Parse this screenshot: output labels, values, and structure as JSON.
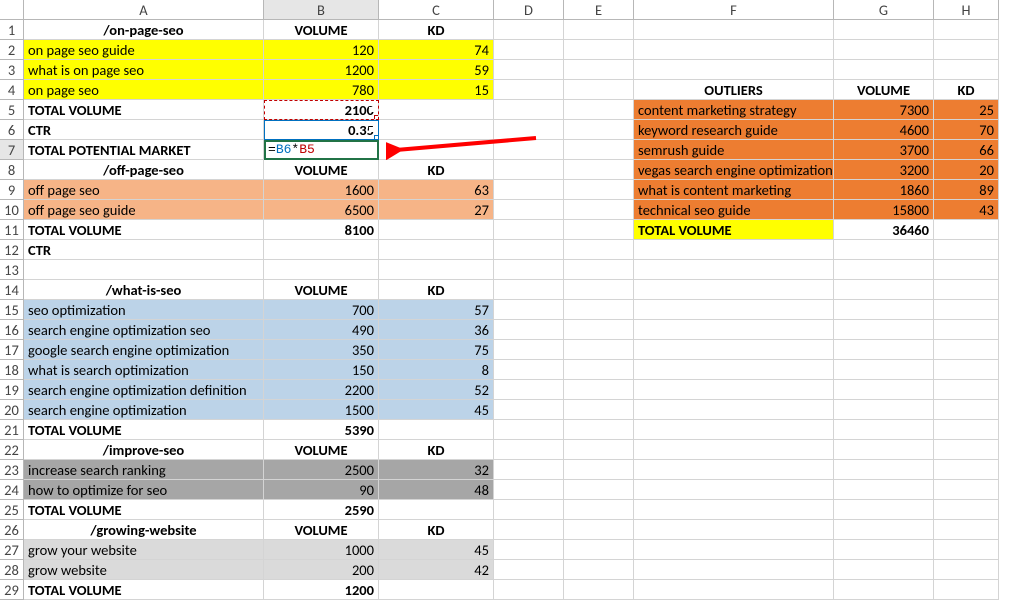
{
  "columns": [
    "A",
    "B",
    "C",
    "D",
    "E",
    "F",
    "G",
    "H"
  ],
  "chart_data": null,
  "header1": {
    "A": "/on-page-seo",
    "B": "VOLUME",
    "C": "KD"
  },
  "onpage": [
    {
      "A": "on page seo guide",
      "B": "120",
      "C": "74"
    },
    {
      "A": "what is on page seo",
      "B": "1200",
      "C": "59"
    },
    {
      "A": "on page seo",
      "B": "780",
      "C": "15"
    }
  ],
  "totalvol1": {
    "A": "TOTAL VOLUME",
    "B": "2100"
  },
  "ctr1": {
    "A": "CTR",
    "B": "0.35"
  },
  "tpm": {
    "A": "TOTAL POTENTIAL MARKET",
    "formula_prefix": "=",
    "ref1": "B6",
    "op": "*",
    "ref2": "B5"
  },
  "header2": {
    "A": "/off-page-seo",
    "B": "VOLUME",
    "C": "KD"
  },
  "offpage": [
    {
      "A": "off page seo",
      "B": "1600",
      "C": "63"
    },
    {
      "A": "off page seo guide",
      "B": "6500",
      "C": "27"
    }
  ],
  "totalvol2": {
    "A": "TOTAL VOLUME",
    "B": "8100"
  },
  "ctr2": {
    "A": "CTR"
  },
  "header3": {
    "A": "/what-is-seo",
    "B": "VOLUME",
    "C": "KD"
  },
  "whatis": [
    {
      "A": "seo optimization",
      "B": "700",
      "C": "57"
    },
    {
      "A": "search engine optimization seo",
      "B": "490",
      "C": "36"
    },
    {
      "A": "google search engine optimization",
      "B": "350",
      "C": "75"
    },
    {
      "A": "what is search optimization",
      "B": "150",
      "C": "8"
    },
    {
      "A": "search engine optimization definition",
      "B": "2200",
      "C": "52"
    },
    {
      "A": "search engine optimization",
      "B": "1500",
      "C": "45"
    }
  ],
  "totalvol3": {
    "A": "TOTAL VOLUME",
    "B": "5390"
  },
  "header4": {
    "A": "/improve-seo",
    "B": "VOLUME",
    "C": "KD"
  },
  "improve": [
    {
      "A": "increase search ranking",
      "B": "2500",
      "C": "32"
    },
    {
      "A": "how to optimize for seo",
      "B": "90",
      "C": "48"
    }
  ],
  "totalvol4": {
    "A": "TOTAL VOLUME",
    "B": "2590"
  },
  "header5": {
    "A": "/growing-website",
    "B": "VOLUME",
    "C": "KD"
  },
  "growing": [
    {
      "A": "grow your website",
      "B": "1000",
      "C": "45"
    },
    {
      "A": "grow website",
      "B": "200",
      "C": "42"
    }
  ],
  "totalvol5": {
    "A": "TOTAL VOLUME",
    "B": "1200"
  },
  "outliers_head": {
    "F": "OUTLIERS",
    "G": "VOLUME",
    "H": "KD"
  },
  "outliers": [
    {
      "F": "content marketing strategy",
      "G": "7300",
      "H": "25"
    },
    {
      "F": "keyword research guide",
      "G": "4600",
      "H": "70"
    },
    {
      "F": "semrush guide",
      "G": "3700",
      "H": "66"
    },
    {
      "F": "vegas search engine optimization",
      "G": "3200",
      "H": "20"
    },
    {
      "F": "what is content marketing",
      "G": "1860",
      "H": "89"
    },
    {
      "F": "technical seo guide",
      "G": "15800",
      "H": "43"
    }
  ],
  "outliers_total": {
    "F": "TOTAL VOLUME",
    "G": "36460"
  }
}
